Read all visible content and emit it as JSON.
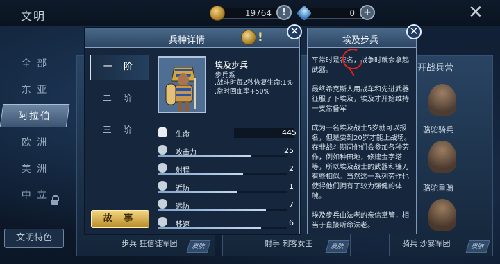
{
  "header": {
    "title": "文明",
    "gold": {
      "value": "19764",
      "icon": "gold-coin-icon",
      "button": "!"
    },
    "gems": {
      "value": "0",
      "icon": "gem-icon",
      "button": "+"
    },
    "close_symbol": "✕"
  },
  "nav": {
    "items": [
      {
        "label": "全 部"
      },
      {
        "label": "东 亚"
      },
      {
        "label": "阿拉伯"
      },
      {
        "label": "欧 洲"
      },
      {
        "label": "美 洲"
      },
      {
        "label": "中 立"
      }
    ],
    "active_index": 2,
    "feature_button": "文明特色"
  },
  "background": {
    "left_card_label": "步兵  狂信徒军团",
    "left_skin": "皮肤",
    "mid_card_label": "射手  刺客女王",
    "mid_skin": "皮肤",
    "right_card_title": "开战兵营",
    "right_units": [
      "骆驼骑兵",
      "骆驼重骑"
    ],
    "right_card_label": "骑兵  沙暴军团",
    "right_skin": "皮肤"
  },
  "detail": {
    "title": "兵种详情",
    "info_icon": "!",
    "close_symbol": "✕",
    "tiers": [
      "一 阶",
      "二 阶",
      "三 阶"
    ],
    "active_tier": 0,
    "story_button": "故 事",
    "unit": {
      "name": "埃及步兵",
      "type": "步兵系",
      "desc_line1": ".战斗时每2秒恢复生命:1%",
      "desc_line2": ".常时回血率+50%"
    },
    "stats": [
      {
        "key": "life",
        "label": "生命",
        "value": "445",
        "icon": "heart-icon"
      },
      {
        "key": "attack",
        "label": "攻击力",
        "value": "25",
        "icon": "swords-icon",
        "fill": 0.72
      },
      {
        "key": "range",
        "label": "射程",
        "value": "2",
        "icon": "target-icon",
        "fill": 0.66
      },
      {
        "key": "melee_def",
        "label": "近防",
        "value": "1",
        "icon": "shield-icon",
        "fill": 0.62
      },
      {
        "key": "ranged_def",
        "label": "远防",
        "value": "7",
        "icon": "shield-arrow-icon",
        "fill": 0.84
      },
      {
        "key": "speed",
        "label": "移速",
        "value": "6",
        "icon": "boots-icon",
        "fill": 0.8
      }
    ]
  },
  "history": {
    "title": "埃及步兵",
    "close_symbol": "✕",
    "paragraphs": [
      "平常时是农名，战争时就会拿起武器。",
      "最终希克斯人用战车和先进武器征服了下埃及，埃及才开始维持一支常备军",
      "成为一名埃及战士5岁就可以报名，但是要到20岁才能上战场。在非战斗期间他们会参加各种劳作，例如种田地，修建金字塔等，所以埃及战士的武器和镰刀有些相似。当然这一系列劳作也使得他们拥有了较为强健的体魄。",
      "埃及步兵由法老的亲信掌管，相当于直接听命法老。"
    ]
  }
}
